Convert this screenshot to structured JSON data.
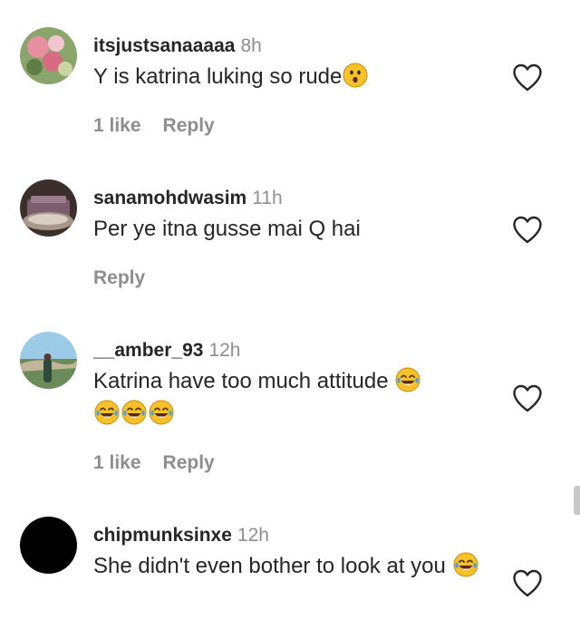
{
  "comments": [
    {
      "username": "itsjustsanaaaaa",
      "time": "8h",
      "text": "Y is katrina luking so rude",
      "emoji_trail": [
        "hushed-face-emoji"
      ],
      "likes": "1 like",
      "reply": "Reply"
    },
    {
      "username": "sanamohdwasim",
      "time": "11h",
      "text": "Per ye itna gusse mai Q hai",
      "emoji_trail": [],
      "likes": "",
      "reply": "Reply"
    },
    {
      "username": "__amber_93",
      "time": "12h",
      "text": "Katrina have too much attitude",
      "emoji_trail": [
        "face-with-tears-of-joy-emoji",
        "face-with-tears-of-joy-emoji",
        "face-with-tears-of-joy-emoji",
        "face-with-tears-of-joy-emoji"
      ],
      "likes": "1 like",
      "reply": "Reply"
    },
    {
      "username": "chipmunksinxe",
      "time": "12h",
      "text": "She didn't even bother to look at you",
      "emoji_trail": [
        "face-with-tears-of-joy-emoji"
      ],
      "likes": "",
      "reply": ""
    }
  ],
  "icons": {
    "like": "heart-outline-icon"
  },
  "colors": {
    "text": "#262626",
    "muted": "#8e8e8e",
    "emoji_yellow": "#f7c12a",
    "tear_blue": "#4aa3e8"
  }
}
